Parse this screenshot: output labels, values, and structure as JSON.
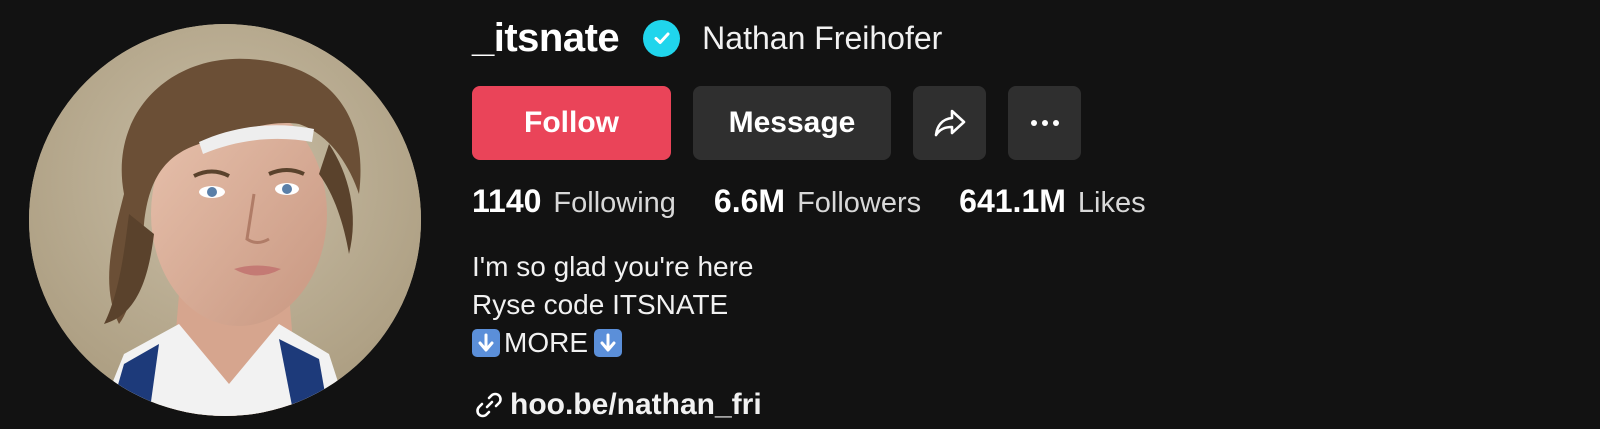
{
  "profile": {
    "username": "_itsnate",
    "display_name": "Nathan Freihofer",
    "verified": true
  },
  "actions": {
    "follow_label": "Follow",
    "message_label": "Message",
    "share_icon": "share-arrow-icon",
    "more_icon": "more-dots-icon"
  },
  "stats": {
    "following": {
      "value": "1140",
      "label": "Following"
    },
    "followers": {
      "value": "6.6M",
      "label": "Followers"
    },
    "likes": {
      "value": "641.1M",
      "label": "Likes"
    }
  },
  "bio": {
    "line1": "I'm so glad you're here",
    "line2": "Ryse code ITSNATE",
    "line3": "MORE"
  },
  "link": {
    "text": "hoo.be/nathan_fri"
  },
  "colors": {
    "background": "#121212",
    "follow": "#ea4459",
    "secondary_button": "#2f2f2f",
    "verified": "#20d5ec"
  }
}
